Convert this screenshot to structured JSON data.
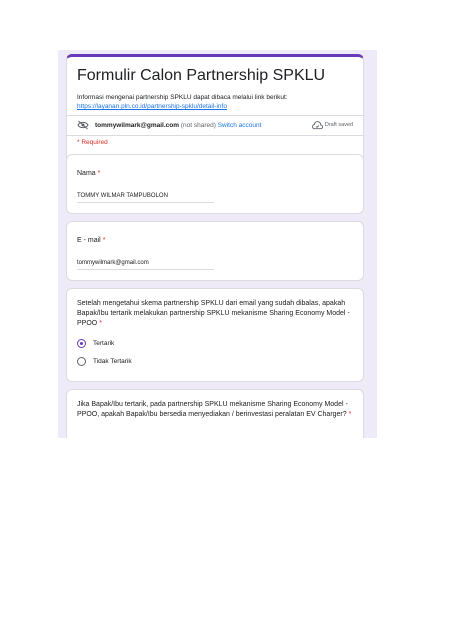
{
  "form": {
    "title": "Formulir Calon Partnership SPKLU",
    "description": "Informasi mengenai partnership SPKLU dapat dibaca melalui link berikut:",
    "link": "https://layanan.pln.co.id/partnership-spklu/detail-info",
    "account_email": "tommywilmark@gmail.com",
    "not_shared": "(not shared)",
    "switch_account": "Switch account",
    "draft_status": "Draft saved",
    "required_note": "* Required"
  },
  "questions": [
    {
      "label": "Nama",
      "required_mark": "*",
      "answer": "TOMMY WILMAR TAMPUBOLON"
    },
    {
      "label": "E - mail",
      "required_mark": "*",
      "answer": "tommywilmark@gmail.com"
    },
    {
      "label": "Setelah mengetahui skema partnership SPKLU dari email yang sudah dibalas, apakah Bapak/Ibu tertarik melakukan partnership SPKLU mekanisme Sharing Economy Model - PPOO",
      "required_mark": "*",
      "options": [
        {
          "label": "Tertarik",
          "selected": true
        },
        {
          "label": "Tidak Tertarik",
          "selected": false
        }
      ]
    },
    {
      "label": "Jika Bapak/Ibu tertarik, pada partnership SPKLU mekanisme Sharing Economy Model - PPOO, apakah Bapak/Ibu bersedia menyediakan / berinvestasi peralatan EV Charger?",
      "required_mark": "*"
    }
  ],
  "colors": {
    "accent": "#673ab7",
    "background": "#efeaf7",
    "link": "#1a73e8",
    "required": "#d93025"
  },
  "icons": [
    "visibility-off-icon",
    "cloud-done-icon"
  ]
}
